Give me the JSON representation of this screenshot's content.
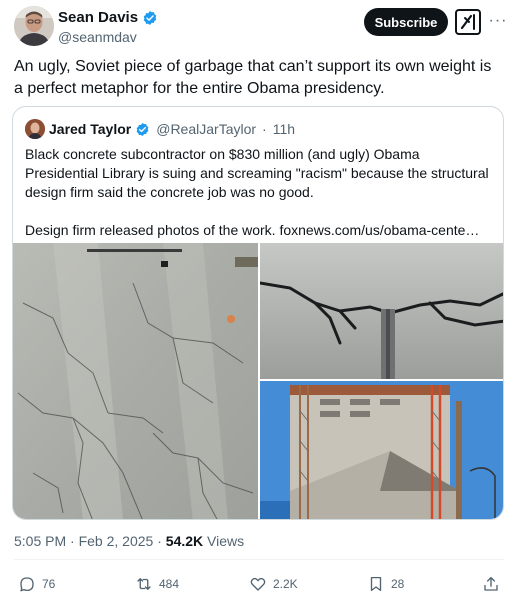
{
  "author": {
    "name": "Sean Davis",
    "handle": "@seanmdav",
    "verified_icon": "verified-badge-icon"
  },
  "header": {
    "subscribe_label": "Subscribe",
    "grok_icon": "grok-icon",
    "more_icon": "more-icon",
    "more_glyph": "···"
  },
  "tweet": {
    "text": "An ugly, Soviet piece of garbage that can’t support its own weight is a perfect metaphor for the entire Obama presidency.",
    "time": "5:05 PM",
    "date": "Feb 2, 2025",
    "separator": "·",
    "views_count": "54.2K",
    "views_label": "Views"
  },
  "quoted_tweet": {
    "name": "Jared Taylor",
    "handle": "@RealJarTaylor",
    "separator": "·",
    "age": "11h",
    "paragraph_1": "Black concrete subcontractor on $830 million (and ugly) Obama Presidential Library is suing and screaming \"racism\" because the structural design firm said the concrete job was no good.",
    "paragraph_2": "Design firm released photos of the work. foxnews.com/us/obama-cente…",
    "images": [
      {
        "name": "cracked-concrete-floor-photo"
      },
      {
        "name": "concrete-crack-closeup-photo"
      },
      {
        "name": "building-construction-photo"
      }
    ]
  },
  "actions": {
    "replies": {
      "icon": "reply-icon",
      "count": "76"
    },
    "reposts": {
      "icon": "repost-icon",
      "count": "484"
    },
    "likes": {
      "icon": "like-icon",
      "count": "2.2K"
    },
    "bookmarks": {
      "icon": "bookmark-icon",
      "count": "28"
    },
    "share": {
      "icon": "share-icon"
    }
  },
  "colors": {
    "text": "#0f1419",
    "secondary": "#536471",
    "verified": "#1d9bf0",
    "border": "#cfd9de"
  }
}
